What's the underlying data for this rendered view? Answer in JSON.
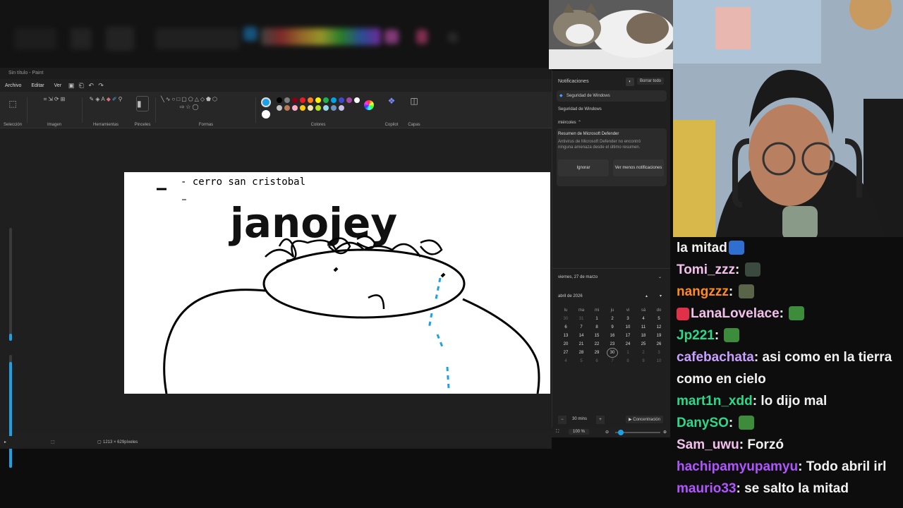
{
  "paint": {
    "title": "Sin título - Paint",
    "menu": [
      "Archivo",
      "Editar",
      "Ver"
    ],
    "ribbon_groups": [
      "Selección",
      "Imagen",
      "Herramientas",
      "Pinceles",
      "Formas",
      "Colores",
      "Copilot",
      "Capas"
    ],
    "canvas_text": {
      "list_item": "- cerro san cristobal",
      "heading": "janojey"
    },
    "status": {
      "canvas_size": "1213 × 629píxeles"
    },
    "colors": [
      "#000000",
      "#7f7f7f",
      "#880015",
      "#ed1c24",
      "#ff7f27",
      "#fff200",
      "#22b14c",
      "#00a2e8",
      "#3f48cc",
      "#a349a4",
      "#ffffff",
      "#c3c3c3",
      "#b97a57",
      "#ffaec9",
      "#ffc90e",
      "#efe4b0",
      "#b5e61d",
      "#99d9ea",
      "#7092be",
      "#c8bfe7"
    ],
    "accent": "#1ea0e6"
  },
  "notifications": {
    "header": "Notificaciones",
    "clear_all": "Borrar todo",
    "app_group": "Seguridad de Windows",
    "subgroup": "Seguridad de Windows",
    "day": "miércoles",
    "card_title": "Resumen de Microsoft Defender",
    "card_body": "Antivirus de Microsoft Defender no encontró ninguna amenaza desde el último resumen.",
    "ignore": "Ignorar",
    "show_less": "Ver menos notificaciones"
  },
  "calendar": {
    "date_header": "viernes, 27 de marzo",
    "month": "abril de 2026",
    "weekdays": [
      "lu",
      "ma",
      "mi",
      "ju",
      "vi",
      "sá",
      "do"
    ],
    "weeks": [
      [
        "30",
        "31",
        "1",
        "2",
        "3",
        "4",
        "5"
      ],
      [
        "6",
        "7",
        "8",
        "9",
        "10",
        "11",
        "12"
      ],
      [
        "13",
        "14",
        "15",
        "16",
        "17",
        "18",
        "19"
      ],
      [
        "20",
        "21",
        "22",
        "23",
        "24",
        "25",
        "26"
      ],
      [
        "27",
        "28",
        "29",
        "30",
        "1",
        "2",
        "3"
      ],
      [
        "4",
        "5",
        "6",
        "7",
        "8",
        "9",
        "10"
      ]
    ],
    "focus_minutes": "30 mins",
    "focus_label": "▶ Concentración",
    "zoom": "100 %"
  },
  "chat": [
    {
      "user": "",
      "text": "la mitad",
      "user_color": "#ffffff",
      "emote": "#2f6fd0"
    },
    {
      "user": "Tomi_zzz",
      "text": "",
      "user_color": "#f2c0ea",
      "emote": "#3b4a3f"
    },
    {
      "user": "nangzzz",
      "text": "",
      "user_color": "#ff8a1e",
      "emote": "#5a6448"
    },
    {
      "user": "LanaLovelace",
      "text": "",
      "user_color": "#f2c0ea",
      "emote": "#3c8c3c",
      "badge": "#e0304a"
    },
    {
      "user": "Jp221",
      "text": "",
      "user_color": "#2bd98a",
      "emote": "#3c8c3c"
    },
    {
      "user": "cafebachata",
      "text": "asi como en la tierra como en cielo",
      "user_color": "#c9a0ff"
    },
    {
      "user": "mart1n_xdd",
      "text": "lo dijo mal",
      "user_color": "#2bd98a"
    },
    {
      "user": "DanySO",
      "text": "",
      "user_color": "#2bd98a",
      "emote": "#3c8c3c"
    },
    {
      "user": "Sam_uwu",
      "text": "Forzó",
      "user_color": "#f2c0ea"
    },
    {
      "user": "hachipamyupamyu",
      "text": "Todo abril irl",
      "user_color": "#b055ff"
    },
    {
      "user": "maurio33",
      "text": "se salto la mitad",
      "user_color": "#b055ff"
    }
  ]
}
